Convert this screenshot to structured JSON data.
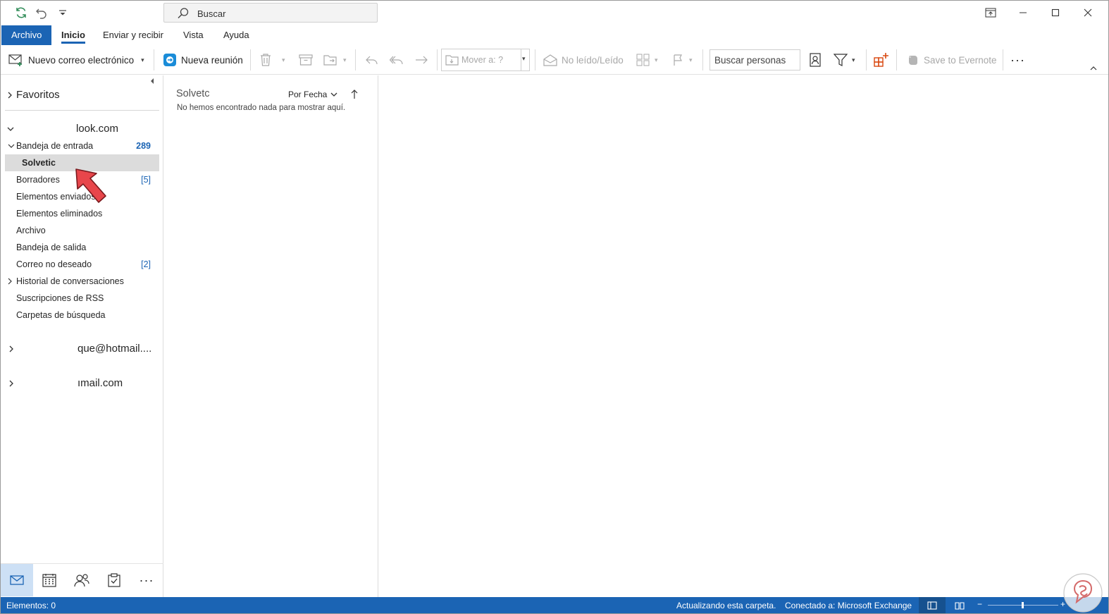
{
  "titlebar": {
    "search_label": "Buscar",
    "icons": [
      "refresh-icon",
      "undo-icon",
      "customize-qat-icon",
      "ribbon-display-icon",
      "minimize-icon",
      "maximize-icon",
      "close-icon"
    ]
  },
  "tabs": {
    "file": "Archivo",
    "items": [
      "Inicio",
      "Enviar y recibir",
      "Vista",
      "Ayuda"
    ]
  },
  "toolbar": {
    "new_email": "Nuevo correo electrónico",
    "new_meeting": "Nueva reunión",
    "move_to": "Mover a: ?",
    "unread_read": "No leído/Leído",
    "search_people": "Buscar personas",
    "evernote": "Save to Evernote",
    "more": "···"
  },
  "folders": {
    "favorites": "Favoritos",
    "account1": "look.com",
    "inbox": "Bandeja de entrada",
    "inbox_count": "289",
    "solvetic": "Solvetic",
    "drafts": "Borradores",
    "drafts_count": "[5]",
    "sent": "Elementos enviados",
    "deleted": "Elementos eliminados",
    "archive": "Archivo",
    "outbox": "Bandeja de salida",
    "junk": "Correo no deseado",
    "junk_count": "[2]",
    "conversation_history": "Historial de conversaciones",
    "rss": "Suscripciones de RSS",
    "search_folders": "Carpetas de búsqueda",
    "account2": "que@hotmail....",
    "account3": "ımail.com"
  },
  "navbar": [
    "mail-icon",
    "calendar-icon",
    "people-icon",
    "tasks-icon",
    "more-icon"
  ],
  "msglist": {
    "title": "Solvetc",
    "sort": "Por Fecha",
    "empty": "No hemos encontrado nada para mostrar aquí."
  },
  "statusbar": {
    "items": "Elementos: 0",
    "updating": "Actualizando esta carpeta.",
    "connected": "Conectado a: Microsoft Exchange",
    "zoom_minus": "−",
    "zoom_plus": "+"
  },
  "colors": {
    "accent": "#1b64b4",
    "arrow": "#e8464b"
  }
}
